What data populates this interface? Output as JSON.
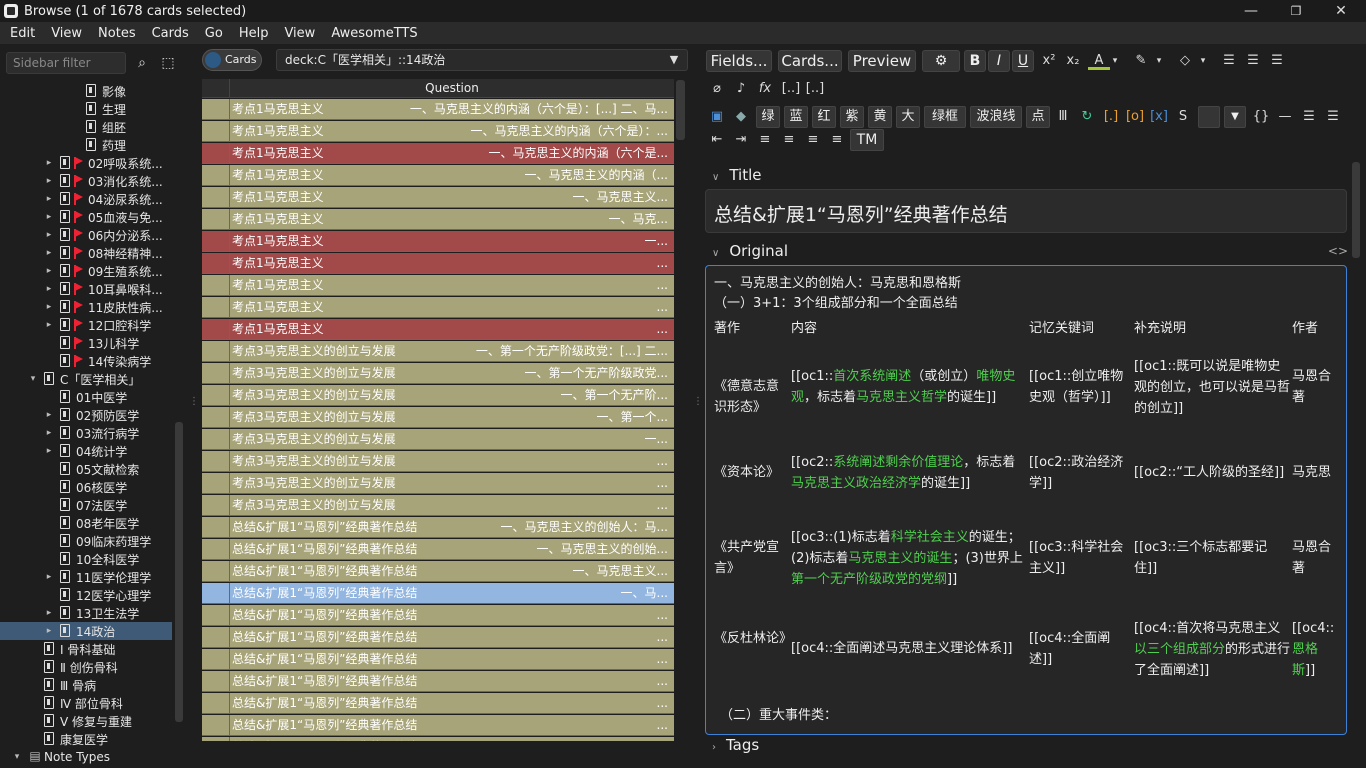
{
  "window": {
    "title": "Browse (1 of 1678 cards selected)",
    "minimize": "—",
    "maximize": "❐",
    "close": "✕"
  },
  "menu": [
    "Edit",
    "View",
    "Notes",
    "Cards",
    "Go",
    "Help",
    "View",
    "AwesomeTTS"
  ],
  "sidebar": {
    "filter_placeholder": "Sidebar filter",
    "items": [
      {
        "label": "影像",
        "indent": 3,
        "icon": "deck"
      },
      {
        "label": "生理",
        "indent": 3,
        "icon": "deck"
      },
      {
        "label": "组胚",
        "indent": 3,
        "icon": "deck"
      },
      {
        "label": "药理",
        "indent": 3,
        "icon": "deck"
      },
      {
        "label": "02呼吸系统...",
        "indent": 2,
        "icon": "deck",
        "flag": true,
        "arrow": "▸"
      },
      {
        "label": "03消化系统...",
        "indent": 2,
        "icon": "deck",
        "flag": true,
        "arrow": "▸"
      },
      {
        "label": "04泌尿系统...",
        "indent": 2,
        "icon": "deck",
        "flag": true,
        "arrow": "▸"
      },
      {
        "label": "05血液与免...",
        "indent": 2,
        "icon": "deck",
        "flag": true,
        "arrow": "▸"
      },
      {
        "label": "06内分泌系...",
        "indent": 2,
        "icon": "deck",
        "flag": true,
        "arrow": "▸"
      },
      {
        "label": "08神经精神...",
        "indent": 2,
        "icon": "deck",
        "flag": true,
        "arrow": "▸"
      },
      {
        "label": "09生殖系统...",
        "indent": 2,
        "icon": "deck",
        "flag": true,
        "arrow": "▸"
      },
      {
        "label": "10耳鼻喉科...",
        "indent": 2,
        "icon": "deck",
        "flag": true,
        "arrow": "▸"
      },
      {
        "label": "11皮肤性病...",
        "indent": 2,
        "icon": "deck",
        "flag": true,
        "arrow": "▸"
      },
      {
        "label": "12口腔科学",
        "indent": 2,
        "icon": "deck",
        "flag": true,
        "arrow": "▸"
      },
      {
        "label": "13儿科学",
        "indent": 2,
        "icon": "deck",
        "flag": true
      },
      {
        "label": "14传染病学",
        "indent": 2,
        "icon": "deck",
        "flag": true
      },
      {
        "label": "C「医学相关」",
        "indent": 1,
        "icon": "deck",
        "arrow": "▾"
      },
      {
        "label": "01中医学",
        "indent": 2,
        "icon": "deck"
      },
      {
        "label": "02预防医学",
        "indent": 2,
        "icon": "deck",
        "arrow": "▸"
      },
      {
        "label": "03流行病学",
        "indent": 2,
        "icon": "deck",
        "arrow": "▸"
      },
      {
        "label": "04统计学",
        "indent": 2,
        "icon": "deck",
        "arrow": "▸"
      },
      {
        "label": "05文献检索",
        "indent": 2,
        "icon": "deck"
      },
      {
        "label": "06核医学",
        "indent": 2,
        "icon": "deck"
      },
      {
        "label": "07法医学",
        "indent": 2,
        "icon": "deck"
      },
      {
        "label": "08老年医学",
        "indent": 2,
        "icon": "deck"
      },
      {
        "label": "09临床药理学",
        "indent": 2,
        "icon": "deck"
      },
      {
        "label": "10全科医学",
        "indent": 2,
        "icon": "deck"
      },
      {
        "label": "11医学伦理学",
        "indent": 2,
        "icon": "deck",
        "arrow": "▸"
      },
      {
        "label": "12医学心理学",
        "indent": 2,
        "icon": "deck"
      },
      {
        "label": "13卫生法学",
        "indent": 2,
        "icon": "deck",
        "arrow": "▸"
      },
      {
        "label": "14政治",
        "indent": 2,
        "icon": "deck",
        "arrow": "▸",
        "selected": true
      },
      {
        "label": "Ⅰ 骨科基础",
        "indent": 1,
        "icon": "deck"
      },
      {
        "label": "Ⅱ 创伤骨科",
        "indent": 1,
        "icon": "deck"
      },
      {
        "label": "Ⅲ 骨病",
        "indent": 1,
        "icon": "deck"
      },
      {
        "label": "Ⅳ 部位骨科",
        "indent": 1,
        "icon": "deck"
      },
      {
        "label": "Ⅴ 修复与重建",
        "indent": 1,
        "icon": "deck"
      },
      {
        "label": "康复医学",
        "indent": 1,
        "icon": "deck"
      },
      {
        "label": "Note Types",
        "indent": 0,
        "icon": "notetypes",
        "arrow": "▾"
      }
    ]
  },
  "browser": {
    "toggle_label": "Cards",
    "search": "deck:C「医学相关」::14政治",
    "column_header": "Question",
    "rows": [
      {
        "sort": "考点1马克思主义",
        "q": "一、马克思主义的内涵（六个是）：[...] 二、马...",
        "state": "normal"
      },
      {
        "sort": "考点1马克思主义",
        "q": "一、马克思主义的内涵（六个是）：...",
        "state": "normal"
      },
      {
        "sort": "考点1马克思主义",
        "q": "一、马克思主义的内涵（六个是...",
        "state": "marked"
      },
      {
        "sort": "考点1马克思主义",
        "q": "一、马克思主义的内涵（...",
        "state": "normal"
      },
      {
        "sort": "考点1马克思主义",
        "q": "一、马克思主义...",
        "state": "normal"
      },
      {
        "sort": "考点1马克思主义",
        "q": "一、马克...",
        "state": "normal"
      },
      {
        "sort": "考点1马克思主义",
        "q": "一...",
        "state": "marked"
      },
      {
        "sort": "考点1马克思主义",
        "q": "...",
        "state": "marked"
      },
      {
        "sort": "考点1马克思主义",
        "q": "...",
        "state": "normal"
      },
      {
        "sort": "考点1马克思主义",
        "q": "...",
        "state": "normal"
      },
      {
        "sort": "考点1马克思主义",
        "q": "...",
        "state": "marked"
      },
      {
        "sort": "考点3马克思主义的创立与发展",
        "q": "一、第一个无产阶级政党：[...] 二...",
        "state": "normal"
      },
      {
        "sort": "考点3马克思主义的创立与发展",
        "q": "一、第一个无产阶级政党...",
        "state": "normal"
      },
      {
        "sort": "考点3马克思主义的创立与发展",
        "q": "一、第一个无产阶...",
        "state": "normal"
      },
      {
        "sort": "考点3马克思主义的创立与发展",
        "q": "一、第一个...",
        "state": "normal"
      },
      {
        "sort": "考点3马克思主义的创立与发展",
        "q": "一...",
        "state": "normal"
      },
      {
        "sort": "考点3马克思主义的创立与发展",
        "q": "...",
        "state": "normal"
      },
      {
        "sort": "考点3马克思主义的创立与发展",
        "q": "...",
        "state": "normal"
      },
      {
        "sort": "考点3马克思主义的创立与发展",
        "q": "...",
        "state": "normal"
      },
      {
        "sort": "总结&扩展1“马恩列”经典著作总结",
        "q": "一、马克思主义的创始人：马...",
        "state": "normal"
      },
      {
        "sort": "总结&扩展1“马恩列”经典著作总结",
        "q": "一、马克思主义的创始...",
        "state": "normal"
      },
      {
        "sort": "总结&扩展1“马恩列”经典著作总结",
        "q": "一、马克思主义...",
        "state": "normal"
      },
      {
        "sort": "总结&扩展1“马恩列”经典著作总结",
        "q": "一、马...",
        "state": "selected"
      },
      {
        "sort": "总结&扩展1“马恩列”经典著作总结",
        "q": "...",
        "state": "normal"
      },
      {
        "sort": "总结&扩展1“马恩列”经典著作总结",
        "q": "...",
        "state": "normal"
      },
      {
        "sort": "总结&扩展1“马恩列”经典著作总结",
        "q": "...",
        "state": "normal"
      },
      {
        "sort": "总结&扩展1“马恩列”经典著作总结",
        "q": "...",
        "state": "normal"
      },
      {
        "sort": "总结&扩展1“马恩列”经典著作总结",
        "q": "...",
        "state": "normal"
      },
      {
        "sort": "总结&扩展1“马恩列”经典著作总结",
        "q": "...",
        "state": "normal"
      },
      {
        "sort": "总结&扩展1“马恩列”经典著作总结",
        "q": "...",
        "state": "normal"
      }
    ]
  },
  "editor": {
    "top_buttons": [
      "Fields...",
      "Cards...",
      "Preview"
    ],
    "format_buttons": [
      "B",
      "I",
      "U",
      "x²",
      "x₂",
      "A",
      "▾",
      "✎",
      "▾",
      "◇",
      "▾",
      "☰",
      "☰",
      "☰"
    ],
    "row3": [
      "绿",
      "蓝",
      "红",
      "紫",
      "黄",
      "大",
      "绿框",
      "波浪线",
      "点"
    ],
    "row4_tm": "TM",
    "title_label": "Title",
    "title_value": "总结&扩展1“马恩列”经典著作总结",
    "original_label": "Original",
    "tags_label": "Tags",
    "orig_line1": "一、马克思主义的创始人：马克思和恩格斯",
    "orig_line2": "（一）3+1：3个组成部分和一个全面总结",
    "table_headers": [
      "著作",
      "内容",
      "记忆关键词",
      "补充说明",
      "作者"
    ],
    "works": [
      {
        "name": "《德意志意识形态》",
        "content_pre": "[[oc1::",
        "content_g1": "首次系统阐述",
        "content_mid": "（或创立）",
        "content_g2": "唯物史观",
        "content_post": "，标志着",
        "content_g3": "马克思主义哲学",
        "content_end": "的诞生]]",
        "keyword": "[[oc1::创立唯物史观（哲学）]]",
        "note": "[[oc1::既可以说是唯物史观的创立，也可以说是马哲的创立]]",
        "author": "马恩合著"
      },
      {
        "name": "《资本论》",
        "content_pre": "[[oc2::",
        "content_g1": "系统阐述剩余价值理论",
        "content_mid": "，标志着",
        "content_g2": "马克思主义政治经济学",
        "content_post": "的诞生]]",
        "keyword": "[[oc2::政治经济学]]",
        "note": "[[oc2::“工人阶级的圣经]]",
        "author": "马克思"
      },
      {
        "name": "《共产党宣言》",
        "content_pre": "[[oc3::(1)标志着",
        "content_g1": "科学社会主义",
        "content_mid": "的诞生；(2)标志着",
        "content_g2": "马克思主义的诞生",
        "content_post": "；(3)世界上",
        "content_g3": "第一个无产阶级政党的党纲",
        "content_end": "]]",
        "keyword": "[[oc3::科学社会主义]]",
        "note": "[[oc3::三个标志都要记住]]",
        "author": "马恩合著"
      },
      {
        "name": "《反杜林论》",
        "content_pre": "[[oc4::全面阐述马克思主义理论体系]]",
        "keyword": "[[oc4::全面阐述]]",
        "note_pre": "[[oc4::首次将马克思主义",
        "note_g": "以三个组成部分",
        "note_post": "的形式进行了全面阐述]]",
        "author_pre": "[[oc4::",
        "author_g": "恩格斯",
        "author_post": "]]"
      }
    ],
    "orig_line3": "（二）重大事件类："
  },
  "colors": {
    "row_normal": "#a8a47a",
    "row_marked": "#a24a4a",
    "row_selected": "#93b6e0",
    "focus": "#3b82d8",
    "green_text": "#4ed04e"
  }
}
